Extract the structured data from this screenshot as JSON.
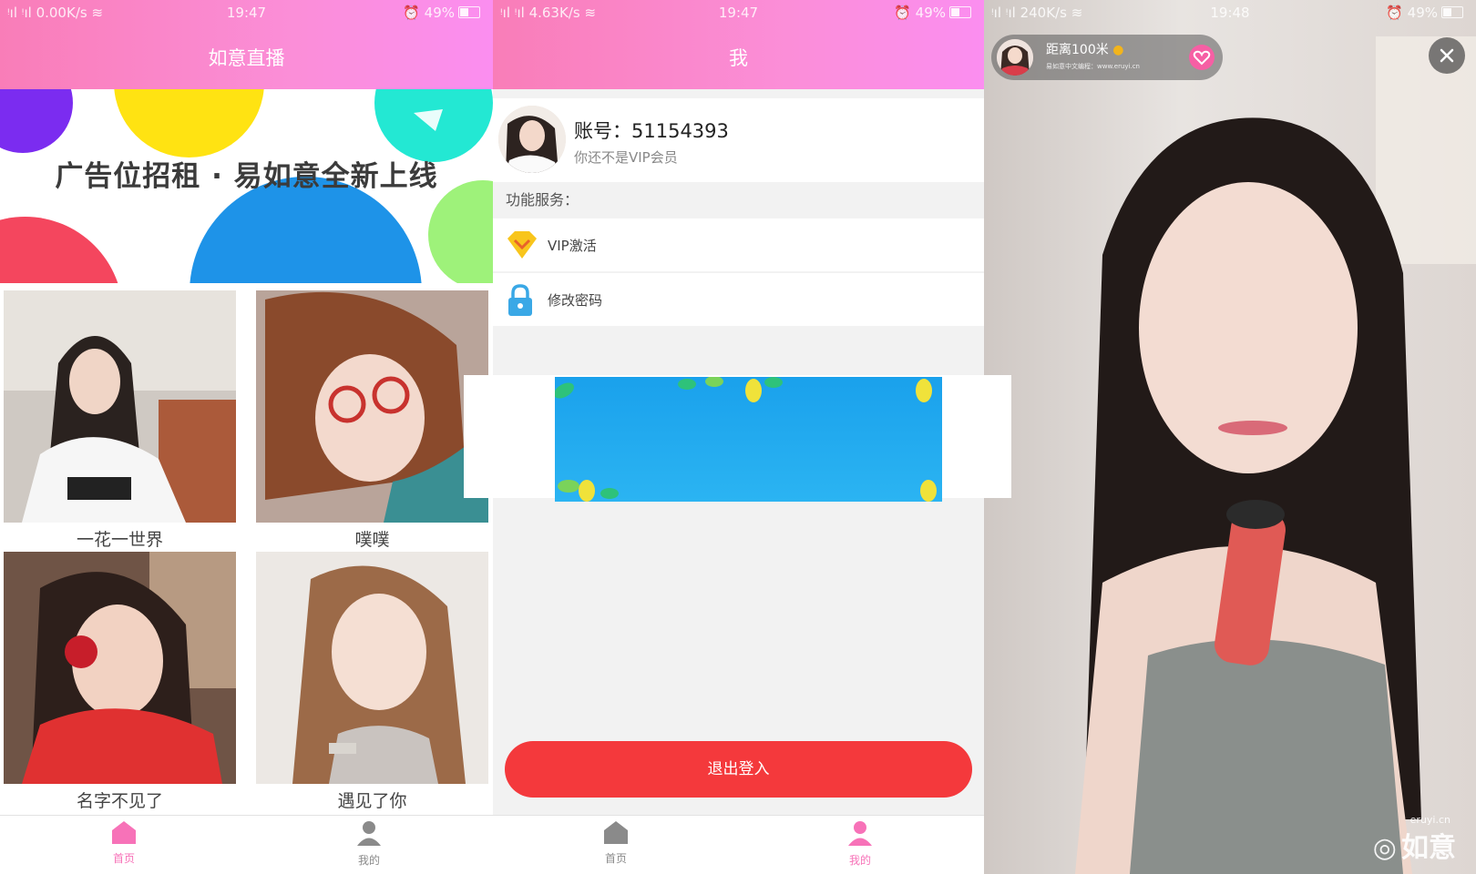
{
  "screens": [
    {
      "status": {
        "network": "0.00K/s",
        "time": "19:47",
        "battery": "49%"
      },
      "title": "如意直播",
      "banner": {
        "text": "广告位招租 · 易如意全新上线"
      },
      "streamers": [
        {
          "name": "一花一世界"
        },
        {
          "name": "噗噗"
        },
        {
          "name": "名字不见了"
        },
        {
          "name": "遇见了你"
        }
      ],
      "tabs": [
        {
          "label": "首页",
          "icon": "home-icon",
          "active": true
        },
        {
          "label": "我的",
          "icon": "user-icon",
          "active": false
        }
      ]
    },
    {
      "status": {
        "network": "4.63K/s",
        "time": "19:47",
        "battery": "49%"
      },
      "title": "我",
      "profile": {
        "account": "账号：51154393",
        "vip_status": "你还不是VIP会员"
      },
      "section_title": "功能服务：",
      "menu": [
        {
          "label": "VIP激活",
          "icon": "vip-diamond-icon"
        },
        {
          "label": "修改密码",
          "icon": "lock-icon"
        }
      ],
      "logout_label": "退出登入",
      "tabs": [
        {
          "label": "首页",
          "icon": "home-icon",
          "active": false
        },
        {
          "label": "我的",
          "icon": "user-icon",
          "active": true
        }
      ]
    },
    {
      "status": {
        "network": "240K/s",
        "time": "19:48",
        "battery": "49%"
      },
      "host": {
        "name": "距离100米",
        "subtitle": "易如意中文编程：www.eruyi.cn"
      },
      "watermark": {
        "site": "eruyi.cn",
        "brand": "如意"
      }
    }
  ],
  "colors": {
    "header_gradient_start": "#f97db8",
    "header_gradient_end": "#fb8ef0",
    "active_tab": "#f772b8",
    "inactive_tab": "#8a8a8a",
    "logout_button": "#f4393c"
  }
}
